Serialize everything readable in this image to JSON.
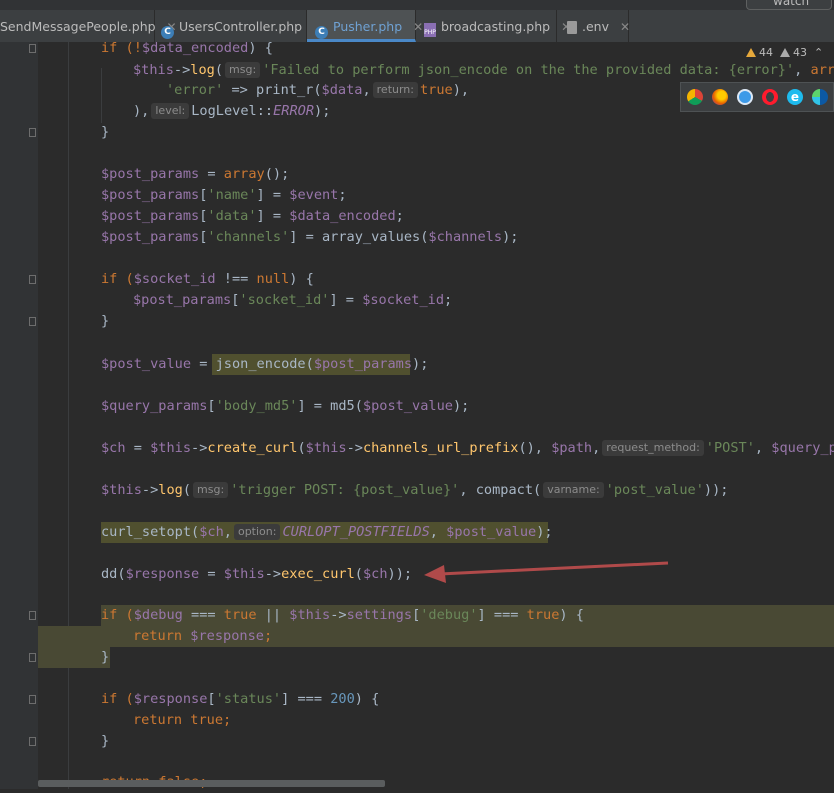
{
  "top_button": {
    "label": "watch"
  },
  "tabs": [
    {
      "label": "SendMessagePeople.php",
      "icon": "php-class-icon",
      "active": false
    },
    {
      "label": "UsersController.php",
      "icon": "php-class-icon",
      "active": false
    },
    {
      "label": "Pusher.php",
      "icon": "php-class-icon",
      "active": true
    },
    {
      "label": "broadcasting.php",
      "icon": "php-file-icon",
      "active": false
    },
    {
      "label": ".env",
      "icon": "env-file-icon",
      "active": false
    }
  ],
  "inspections": {
    "warnings": "44",
    "weak_warnings": "43"
  },
  "browsers": [
    "chrome-icon",
    "firefox-icon",
    "safari-icon",
    "opera-icon",
    "ie-icon",
    "edge-icon"
  ],
  "code": {
    "l1": {
      "a": "if (!",
      "b": "$data_encoded",
      "c": ") {"
    },
    "l2": {
      "a": "$this",
      "b": "->",
      "c": "log",
      "d": "(",
      "hint": "msg:",
      "e": "'Failed to perform json_encode on the the provided data: {error}'",
      "f": ", ",
      "g": "array"
    },
    "l3": {
      "a": "'error'",
      "b": " => ",
      "c": "print_r",
      "d": "(",
      "e": "$data",
      "f": ",",
      "hint": "return:",
      "g": "true",
      "h": "),"
    },
    "l4": {
      "a": "),",
      "hint": "level:",
      "b": "LogLevel::",
      "c": "ERROR",
      "d": ");"
    },
    "l5": {
      "a": "}"
    },
    "l6": {
      "a": "$post_params",
      "b": " = ",
      "c": "array",
      "d": "();"
    },
    "l7": {
      "a": "$post_params",
      "b": "[",
      "c": "'name'",
      "d": "] = ",
      "e": "$event",
      "f": ";"
    },
    "l8": {
      "a": "$post_params",
      "b": "[",
      "c": "'data'",
      "d": "] = ",
      "e": "$data_encoded",
      "f": ";"
    },
    "l9": {
      "a": "$post_params",
      "b": "[",
      "c": "'channels'",
      "d": "] = array_values(",
      "e": "$channels",
      "f": ");"
    },
    "l10": {
      "a": "if (",
      "b": "$socket_id",
      "c": " !== ",
      "d": "null",
      "e": ") {"
    },
    "l11": {
      "a": "$post_params",
      "b": "[",
      "c": "'socket_id'",
      "d": "] = ",
      "e": "$socket_id",
      "f": ";"
    },
    "l12": {
      "a": "}"
    },
    "l13": {
      "a": "$post_value",
      "b": " = ",
      "c": "json_encode(",
      "d": "$post_params",
      "e": ");"
    },
    "l14": {
      "a": "$query_params",
      "b": "[",
      "c": "'body_md5'",
      "d": "] = md5(",
      "e": "$post_value",
      "f": ");"
    },
    "l15": {
      "a": "$ch",
      "b": " = ",
      "c": "$this",
      "d": "->",
      "e": "create_curl",
      "f": "(",
      "g": "$this",
      "h": "->",
      "i": "channels_url_prefix",
      "j": "(), ",
      "k": "$path",
      "l": ",",
      "hint": "request_method:",
      "m": "'POST'",
      "n": ", ",
      "o": "$query_pa"
    },
    "l16": {
      "a": "$this",
      "b": "->",
      "c": "log",
      "d": "(",
      "hint": "msg:",
      "e": "'trigger POST: {post_value}'",
      "f": ", compact(",
      "hint2": "varname:",
      "g": "'post_value'",
      "h": "));"
    },
    "l17": {
      "a": "curl_setopt(",
      "b": "$ch",
      "c": ",",
      "hint": "option:",
      "d": "CURLOPT_POSTFIELDS",
      "e": ", ",
      "f": "$post_value",
      "g": ");"
    },
    "l18": {
      "a": "dd(",
      "b": "$response",
      "c": " = ",
      "d": "$this",
      "e": "->",
      "f": "exec_curl",
      "g": "(",
      "h": "$ch",
      "i": "));"
    },
    "l19": {
      "a": "if (",
      "b": "$debug",
      "c": " === ",
      "d": "true",
      "e": " || ",
      "f": "$this",
      "g": "->",
      "h": "settings",
      "i": "[",
      "j": "'debug'",
      "k": "] === ",
      "l": "true",
      "m": ") {"
    },
    "l20": {
      "a": "return ",
      "b": "$response",
      "c": ";"
    },
    "l21": {
      "a": "}"
    },
    "l22": {
      "a": "if (",
      "b": "$response",
      "c": "[",
      "d": "'status'",
      "e": "] === ",
      "f": "200",
      "g": ") {"
    },
    "l23": {
      "a": "return ",
      "b": "true",
      "c": ";"
    },
    "l24": {
      "a": "}"
    },
    "l25": {
      "a": "return ",
      "b": "false",
      "c": ";"
    }
  }
}
